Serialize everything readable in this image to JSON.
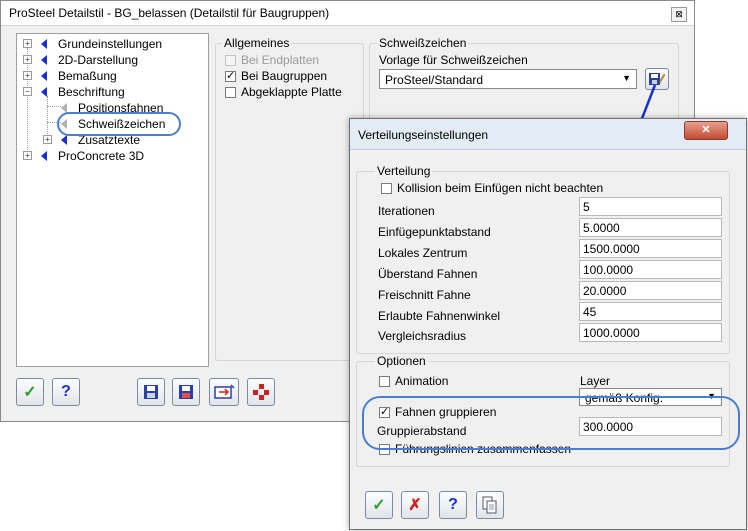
{
  "main_dialog": {
    "title": "ProSteel Detailstil - BG_belassen (Detailstil für Baugruppen)",
    "close_glyph": "⊠",
    "tree": [
      {
        "label": "Grundeinstellungen",
        "expander": "+"
      },
      {
        "label": "2D-Darstellung",
        "expander": "+"
      },
      {
        "label": "Bemaßung",
        "expander": "+"
      },
      {
        "label": "Beschriftung",
        "expander": "−"
      },
      {
        "label": "Positionsfahnen",
        "expander": ""
      },
      {
        "label": "Schweißzeichen",
        "expander": ""
      },
      {
        "label": "Zusatztexte",
        "expander": "+"
      },
      {
        "label": "ProConcrete 3D",
        "expander": "+"
      }
    ],
    "general": {
      "title": "Allgemeines",
      "options": [
        {
          "label": "Bei Endplatten",
          "checked": false,
          "disabled": true
        },
        {
          "label": "Bei Baugruppen",
          "checked": true,
          "disabled": false
        },
        {
          "label": "Abgeklappte Platte",
          "checked": false,
          "disabled": false
        }
      ]
    },
    "weld": {
      "title": "Schweißzeichen",
      "template_label": "Vorlage für Schweißzeichen",
      "template_value": "ProSteel/Standard"
    },
    "check_glyph": "✓",
    "help_glyph": "?"
  },
  "dist_dialog": {
    "title": "Verteilungseinstellungen",
    "close_glyph": "✕",
    "distribution": {
      "title": "Verteilung",
      "collision_label": "Kollision beim Einfügen nicht beachten",
      "collision_checked": false,
      "fields": [
        {
          "label": "Iterationen",
          "value": "5"
        },
        {
          "label": "Einfügepunktabstand",
          "value": "5.0000"
        },
        {
          "label": "Lokales Zentrum",
          "value": "1500.0000"
        },
        {
          "label": "Überstand Fahnen",
          "value": "100.0000"
        },
        {
          "label": "Freischnitt Fahne",
          "value": "20.0000"
        },
        {
          "label": "Erlaubte Fahnenwinkel",
          "value": "45"
        },
        {
          "label": "Vergleichsradius",
          "value": "1000.0000"
        }
      ]
    },
    "options": {
      "title": "Optionen",
      "animation_label": "Animation",
      "animation_checked": false,
      "layer_label": "Layer",
      "layer_value": "gemäß Konfig.",
      "group_label": "Fahnen gruppieren",
      "group_checked": true,
      "group_distance_label": "Gruppierabstand",
      "group_distance_value": "300.0000",
      "combine_label": "Führungslinien zusammenfassen",
      "combine_checked": false
    },
    "check_glyph": "✓",
    "cancel_glyph": "✗",
    "help_glyph": "?"
  },
  "colors": {
    "accent_blue": "#1a2ed8",
    "highlight": "#4a7fd0",
    "ok_green": "#2e9e2e",
    "cancel_red": "#cc2222"
  }
}
